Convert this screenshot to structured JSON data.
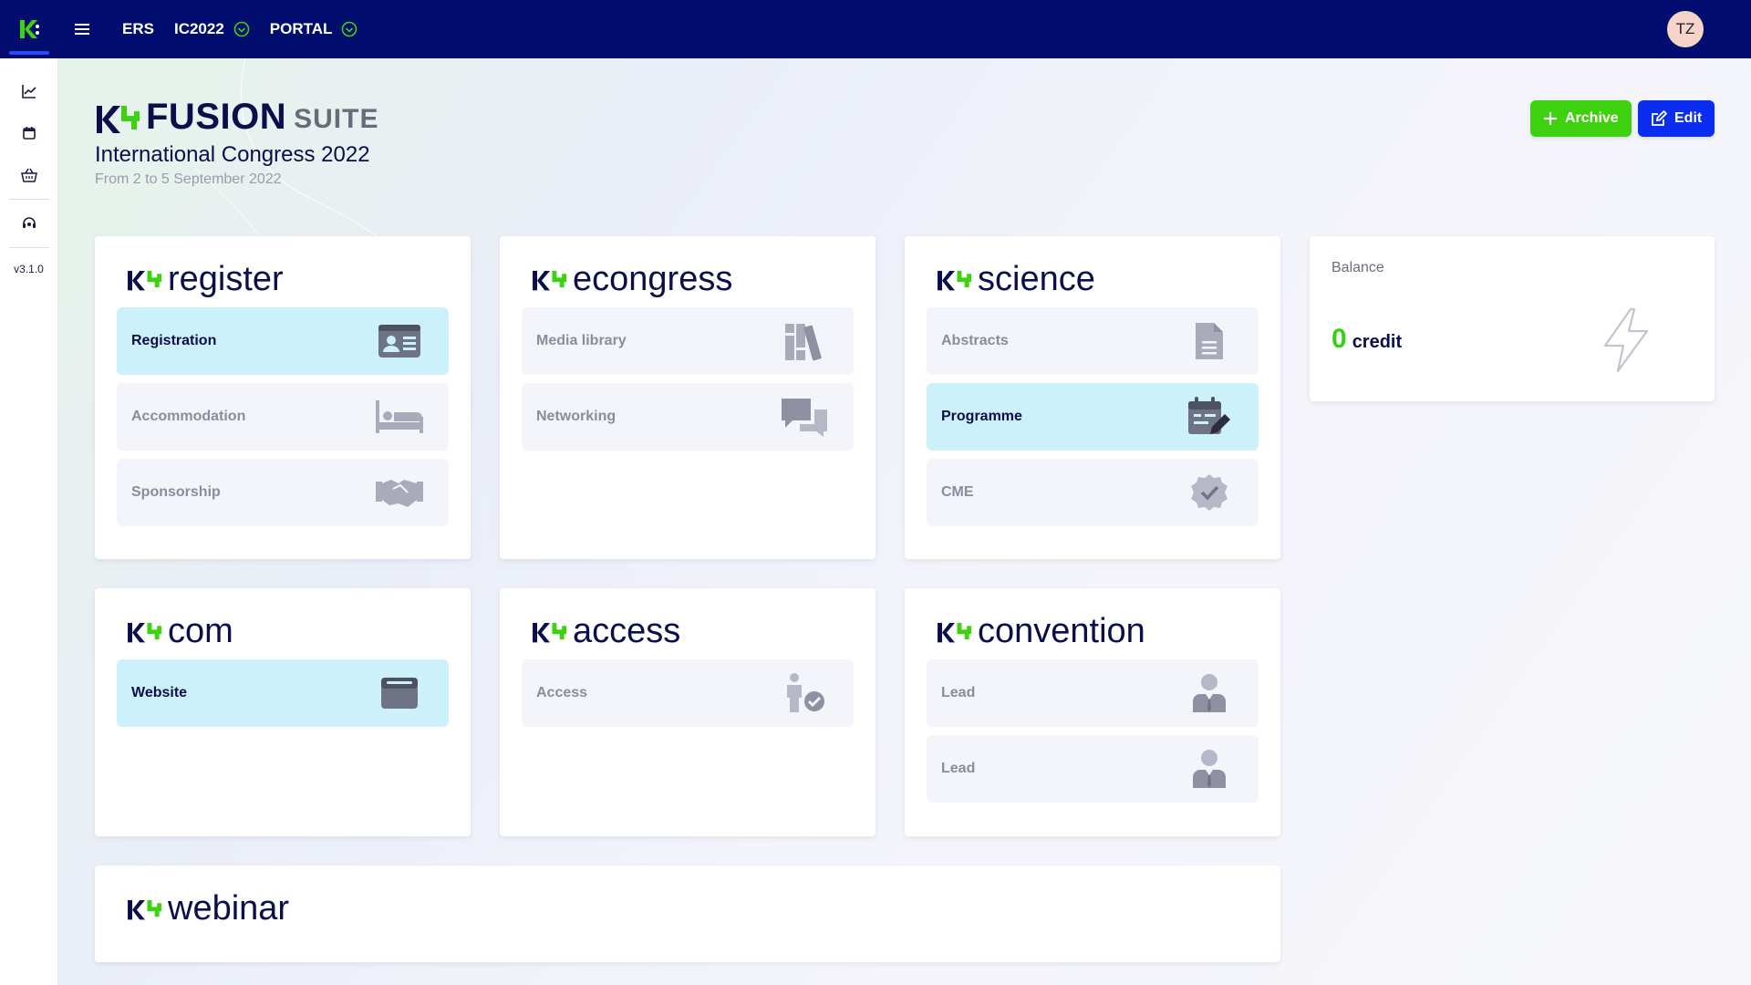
{
  "topbar": {
    "nav": [
      {
        "label": "ERS",
        "status": ""
      },
      {
        "label": "IC2022",
        "status": "check-circle-icon"
      },
      {
        "label": "PORTAL",
        "status": "check-circle-icon"
      }
    ],
    "avatar_initials": "TZ"
  },
  "sidebar": {
    "items": [
      {
        "icon": "chart-line-icon"
      },
      {
        "icon": "calendar-icon"
      },
      {
        "icon": "basket-icon"
      },
      {
        "icon": "headset-icon"
      }
    ],
    "version": "v3.1.0"
  },
  "header": {
    "brand_name": "FUSION",
    "brand_suite": "SUITE",
    "event_title": "International Congress 2022",
    "event_dates": "From 2 to 5 September 2022"
  },
  "actions": {
    "archive_label": "Archive",
    "edit_label": "Edit"
  },
  "modules": {
    "register": {
      "title": "register",
      "tiles": [
        {
          "label": "Registration",
          "icon": "id-card-icon",
          "active": true
        },
        {
          "label": "Accommodation",
          "icon": "bed-icon",
          "active": false
        },
        {
          "label": "Sponsorship",
          "icon": "handshake-icon",
          "active": false
        }
      ]
    },
    "econgress": {
      "title": "econgress",
      "tiles": [
        {
          "label": "Media library",
          "icon": "books-icon",
          "active": false
        },
        {
          "label": "Networking",
          "icon": "chat-bubbles-icon",
          "active": false
        }
      ]
    },
    "science": {
      "title": "science",
      "tiles": [
        {
          "label": "Abstracts",
          "icon": "document-icon",
          "active": false
        },
        {
          "label": "Programme",
          "icon": "calendar-edit-icon",
          "active": true
        },
        {
          "label": "CME",
          "icon": "badge-check-icon",
          "active": false
        }
      ]
    },
    "com": {
      "title": "com",
      "tiles": [
        {
          "label": "Website",
          "icon": "browser-window-icon",
          "active": true
        }
      ]
    },
    "access": {
      "title": "access",
      "tiles": [
        {
          "label": "Access",
          "icon": "person-check-icon",
          "active": false
        }
      ]
    },
    "convention": {
      "title": "convention",
      "tiles": [
        {
          "label": "Lead",
          "icon": "businessman-icon",
          "active": false
        },
        {
          "label": "Lead",
          "icon": "businessman-icon",
          "active": false
        }
      ]
    },
    "webinar": {
      "title": "webinar",
      "tiles": []
    }
  },
  "balance": {
    "label": "Balance",
    "value": "0",
    "unit": "credit",
    "icon": "lightning-icon"
  },
  "colors": {
    "topbar": "#000c6e",
    "brand_green": "#3ed10f",
    "brand_blue": "#0a2df0",
    "active_tile": "#cdf1fb",
    "ink": "#0a0e4a"
  }
}
